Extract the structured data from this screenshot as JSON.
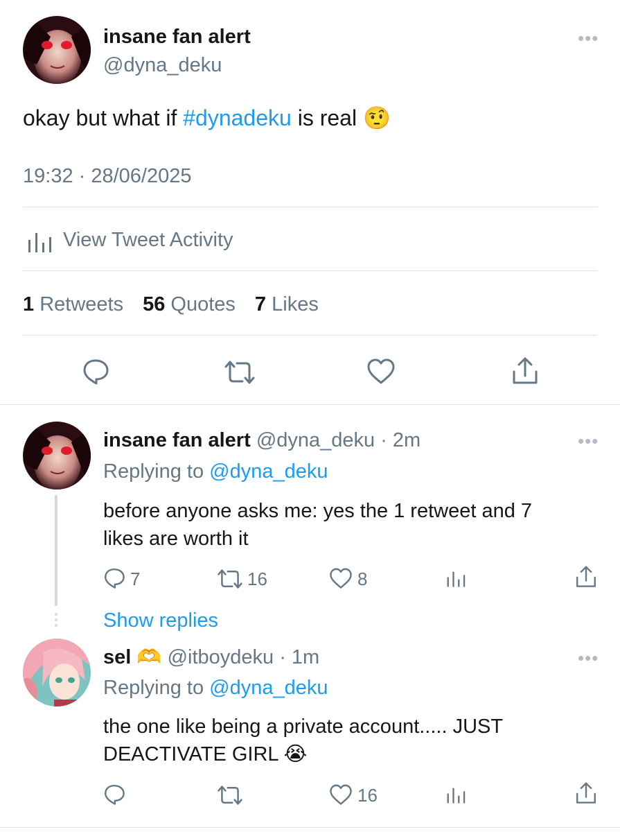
{
  "tweet": {
    "author_name": "insane fan alert",
    "author_handle": "@dyna_deku",
    "text_prefix": "okay but what if ",
    "hashtag": "#dynadeku",
    "text_suffix": " is real",
    "emoji": "🤨",
    "timestamp": "19:32 · 28/06/2025",
    "activity_label": "View Tweet Activity",
    "retweets_count": "1",
    "retweets_label": "Retweets",
    "quotes_count": "56",
    "quotes_label": "Quotes",
    "likes_count": "7",
    "likes_label": "Likes"
  },
  "replies": [
    {
      "author_name": "insane fan alert",
      "author_handle": "@dyna_deku",
      "time": "· 2m",
      "replying_to_label": "Replying to",
      "replying_to_handle": "@dyna_deku",
      "text_line1": "before anyone asks me: yes the 1 retweet and 7",
      "text_line2": "likes are worth it",
      "reply_count": "7",
      "retweet_count": "16",
      "like_count": "8"
    },
    {
      "author_name": "sel",
      "author_badge": "🫶",
      "author_handle": "@itboydeku",
      "time": "· 1m",
      "replying_to_label": "Replying to",
      "replying_to_handle": "@dyna_deku",
      "text_line1": "the one like being a private account..... JUST",
      "text_line2": "DEACTIVATE GIRL",
      "emoji": "😭",
      "like_count": "16"
    }
  ],
  "show_replies_label": "Show replies",
  "icons": [
    "more-icon",
    "activity-icon",
    "reply-icon",
    "retweet-icon",
    "like-icon",
    "share-icon"
  ],
  "colors": {
    "link": "#1d9bf0",
    "secondary_text": "#657786",
    "divider": "#dde3e7"
  }
}
